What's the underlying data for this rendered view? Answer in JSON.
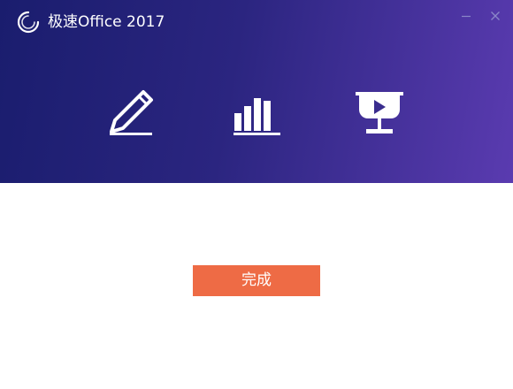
{
  "window": {
    "title": "极速Office 2017"
  },
  "header": {
    "icons": [
      "writer-pen-icon",
      "spreadsheet-chart-icon",
      "presentation-play-icon"
    ]
  },
  "main": {
    "done_label": "完成"
  },
  "colors": {
    "header_gradient_start": "#1a1d6e",
    "header_gradient_end": "#5a3bb0",
    "accent_button": "#ee6b45",
    "window_controls": "#8a86c8"
  }
}
